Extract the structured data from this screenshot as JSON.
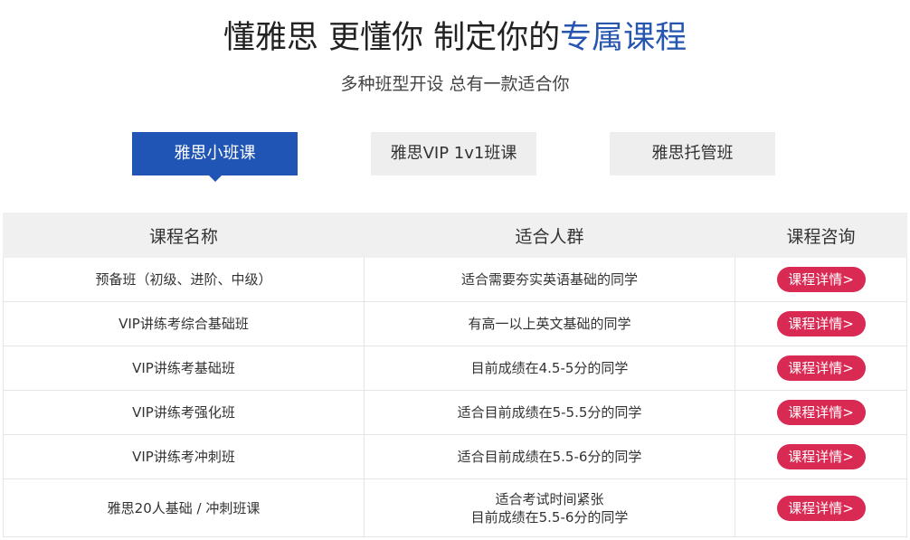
{
  "header": {
    "title_main": "懂雅思 更懂你 制定你的",
    "title_accent": "专属课程",
    "subtitle": "多种班型开设 总有一款适合你"
  },
  "tabs": [
    {
      "label": "雅思小班课",
      "active": true
    },
    {
      "label": "雅思VIP 1v1班课",
      "active": false
    },
    {
      "label": "雅思托管班",
      "active": false
    }
  ],
  "table": {
    "headers": [
      "课程名称",
      "适合人群",
      "课程咨询"
    ],
    "rows": [
      {
        "name": "预备班（初级、进阶、中级）",
        "audience": [
          "适合需要夯实英语基础的同学"
        ],
        "action": "课程详情>"
      },
      {
        "name": "VIP讲练考综合基础班",
        "audience": [
          "有高一以上英文基础的同学"
        ],
        "action": "课程详情>"
      },
      {
        "name": "VIP讲练考基础班",
        "audience": [
          "目前成绩在4.5-5分的同学"
        ],
        "action": "课程详情>"
      },
      {
        "name": "VIP讲练考强化班",
        "audience": [
          "适合目前成绩在5-5.5分的同学"
        ],
        "action": "课程详情>"
      },
      {
        "name": "VIP讲练考冲刺班",
        "audience": [
          "适合目前成绩在5.5-6分的同学"
        ],
        "action": "课程详情>"
      },
      {
        "name": "雅思20人基础 / 冲刺班课",
        "audience": [
          "适合考试时间紧张",
          "目前成绩在5.5-6分的同学"
        ],
        "action": "课程详情>"
      }
    ]
  },
  "colors": {
    "accent_blue": "#2054b5",
    "button_red": "#d92a54",
    "header_gray": "#f0f0f0"
  }
}
